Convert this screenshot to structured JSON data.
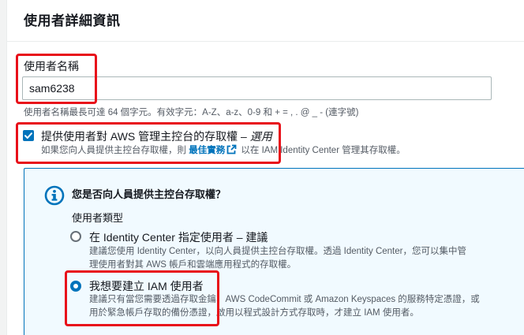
{
  "section": {
    "title": "使用者詳細資訊"
  },
  "username": {
    "label": "使用者名稱",
    "value": "sam6238",
    "constraint": "使用者名稱最長可達 64 個字元。有效字元：A-Z、a-z、0-9 和 + = , . @ _ - (連字號)"
  },
  "console_access": {
    "checked": true,
    "label": "提供使用者對 AWS 管理主控台的存取權",
    "separator": " – ",
    "optional": "選用",
    "desc_prefix": "如果您向人員提供主控台存取權，則",
    "desc_link": "最佳實務",
    "desc_suffix": "以在 IAM Identity Center 管理其存取權。",
    "link_icon": "external-link-icon"
  },
  "info": {
    "icon": "info-icon",
    "title": "您是否向人員提供主控台存取權？",
    "user_type_label": "使用者類型",
    "options": [
      {
        "label": "在 Identity Center 指定使用者 – 建議",
        "selected": false,
        "desc_line1": "建議您使用 Identity Center，以向人員提供主控台存取權。透過 Identity Center，您可以集中管",
        "desc_line2": "理使用者對其 AWS 帳戶和雲端應用程式的存取權。"
      },
      {
        "label": "我想要建立 IAM 使用者",
        "selected": true,
        "desc_line1": "建議只有當您需要透過存取金鑰、AWS CodeCommit 或 Amazon Keyspaces 的服務特定憑證，或",
        "desc_line2": "用於緊急帳戶存取的備份憑證，啟用以程式設計方式存取時，才建立 IAM 使用者。"
      }
    ]
  },
  "colors": {
    "accent": "#0073bb",
    "highlight": "#e8101a",
    "info_bg": "#f1faff"
  }
}
